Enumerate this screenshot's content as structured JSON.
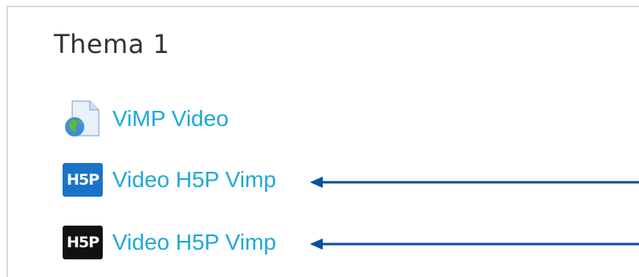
{
  "section": {
    "title": "Thema 1"
  },
  "activities": [
    {
      "label": "ViMP Video",
      "icon": "file-globe-icon"
    },
    {
      "label": "Video H5P Vimp",
      "icon": "h5p-blue-icon",
      "icon_text": "H5P"
    },
    {
      "label": "Video H5P Vimp",
      "icon": "h5p-black-icon",
      "icon_text": "H5P"
    }
  ],
  "colors": {
    "link": "#20a8d8",
    "title": "#333333",
    "arrow": "#0d4f9e",
    "h5p_blue": "#1a73c9",
    "h5p_black": "#111111",
    "border": "#dcdcdc"
  }
}
